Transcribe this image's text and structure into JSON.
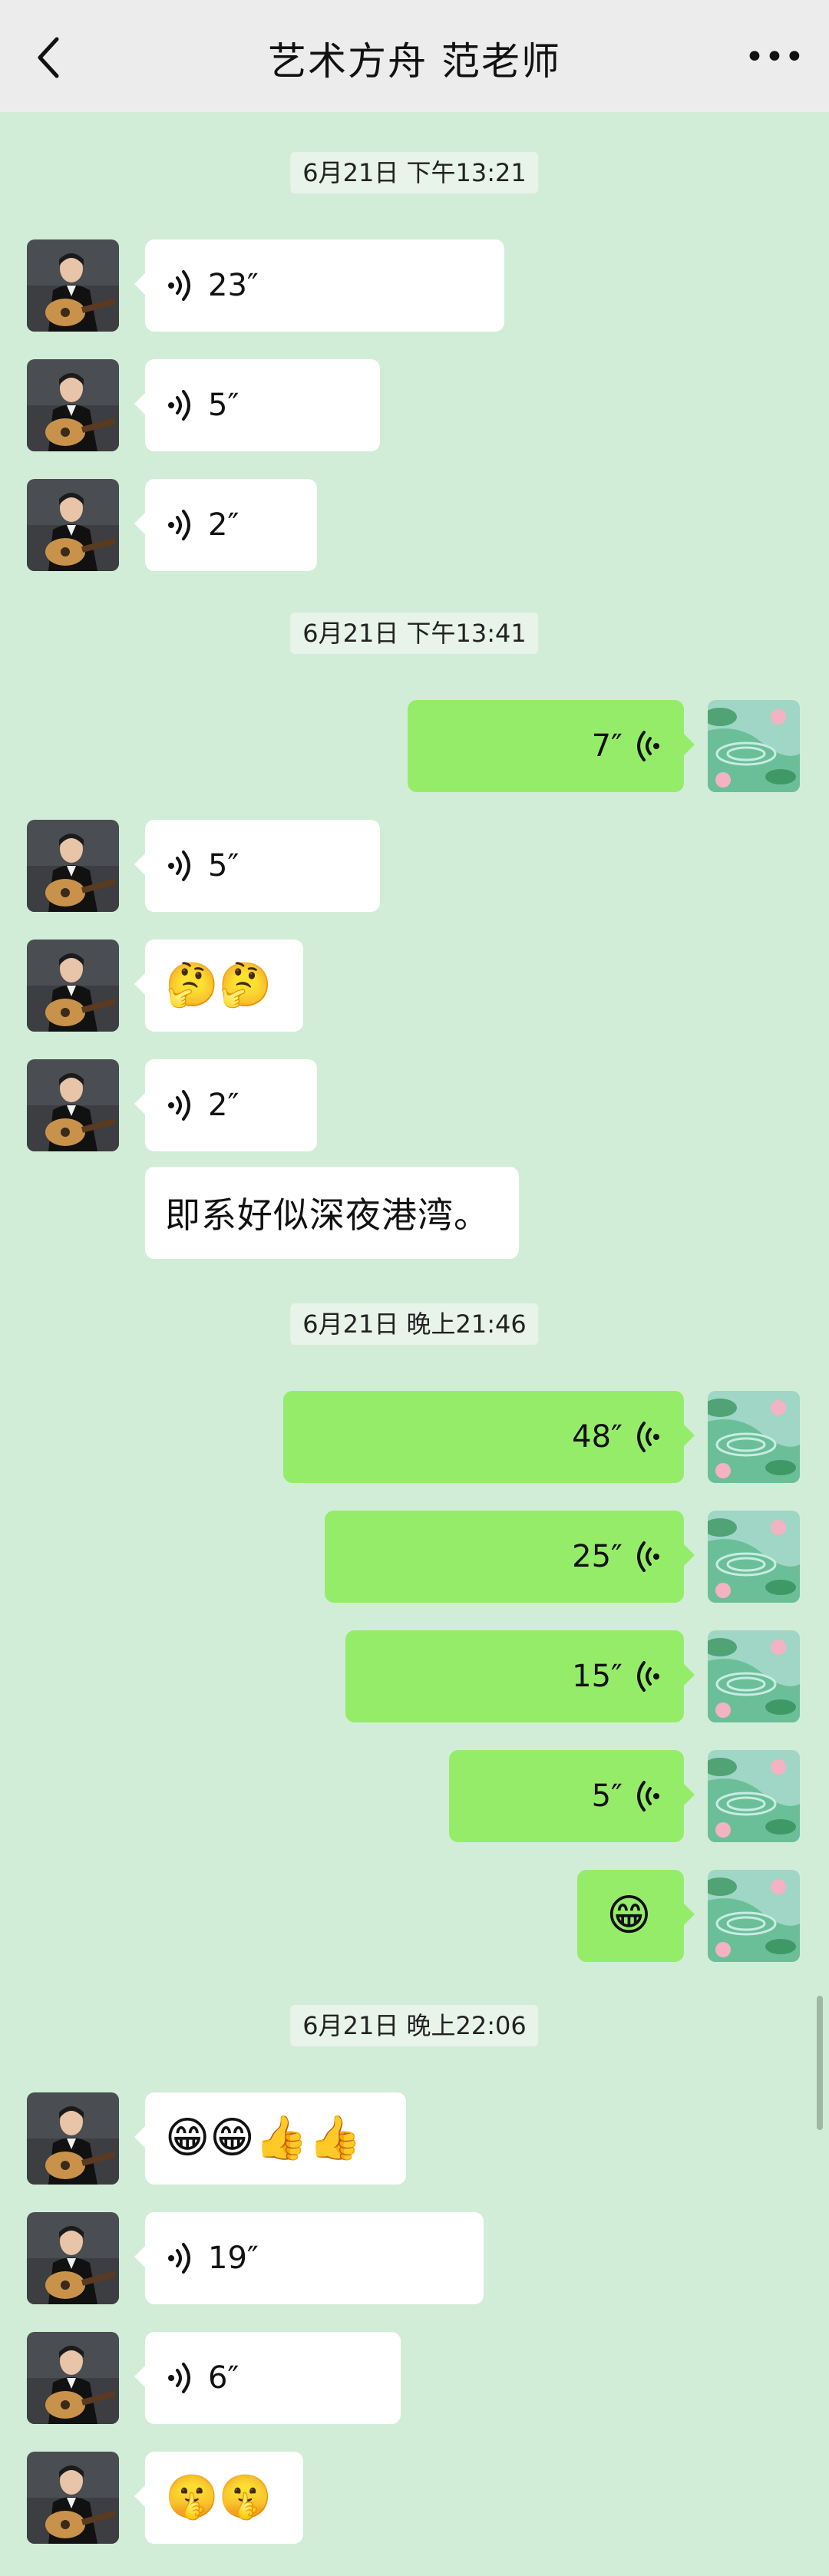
{
  "header": {
    "title": "艺术方舟  范老师",
    "back_icon": "chevron-left-icon",
    "more_icon": "more-dots-icon"
  },
  "colors": {
    "background": "#d2edd7",
    "bubble_out": "#95ec69",
    "bubble_in": "#ffffff",
    "header": "#ececec"
  },
  "messages": [
    {
      "type": "timestamp",
      "text": "6月21日 下午13:21"
    },
    {
      "type": "voice",
      "dir": "in",
      "duration": "23″"
    },
    {
      "type": "voice",
      "dir": "in",
      "duration": "5″"
    },
    {
      "type": "voice",
      "dir": "in",
      "duration": "2″"
    },
    {
      "type": "timestamp",
      "text": "6月21日 下午13:41"
    },
    {
      "type": "voice",
      "dir": "out",
      "duration": "7″"
    },
    {
      "type": "voice",
      "dir": "in",
      "duration": "5″"
    },
    {
      "type": "emoji",
      "dir": "in",
      "content": "🤔🤔"
    },
    {
      "type": "voice",
      "dir": "in",
      "duration": "2″"
    },
    {
      "type": "text",
      "dir": "in",
      "content": "即系好似深夜港湾。"
    },
    {
      "type": "timestamp",
      "text": "6月21日 晚上21:46"
    },
    {
      "type": "voice",
      "dir": "out",
      "duration": "48″"
    },
    {
      "type": "voice",
      "dir": "out",
      "duration": "25″"
    },
    {
      "type": "voice",
      "dir": "out",
      "duration": "15″"
    },
    {
      "type": "voice",
      "dir": "out",
      "duration": "5″"
    },
    {
      "type": "emoji",
      "dir": "out",
      "content": "😁"
    },
    {
      "type": "timestamp",
      "text": "6月21日 晚上22:06"
    },
    {
      "type": "emoji",
      "dir": "in",
      "content": "😁😁👍👍"
    },
    {
      "type": "voice",
      "dir": "in",
      "duration": "19″"
    },
    {
      "type": "voice",
      "dir": "in",
      "duration": "6″"
    },
    {
      "type": "emoji",
      "dir": "in",
      "content": "🤫🤫"
    }
  ]
}
